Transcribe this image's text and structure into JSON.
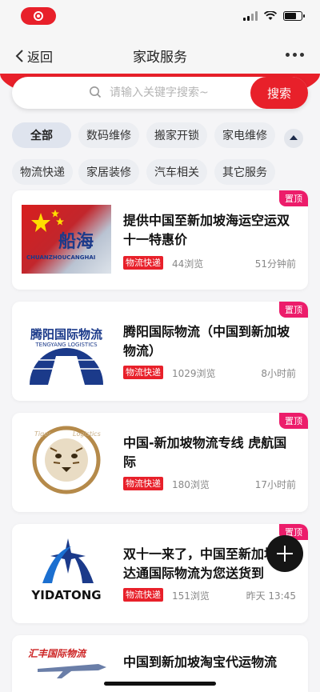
{
  "status_bar": {
    "record_icon": "screen-record-icon"
  },
  "nav": {
    "back_label": "返回",
    "title": "家政服务"
  },
  "search": {
    "placeholder": "请输入关键字搜索~",
    "button_label": "搜索"
  },
  "categories": [
    "全部",
    "数码维修",
    "搬家开锁",
    "家电维修",
    "物流快递",
    "家居装修",
    "汽车相关",
    "其它服务"
  ],
  "colors": {
    "accent": "#e8202a",
    "pin": "#ec1c6a"
  },
  "listings": [
    {
      "pin": "置顶",
      "title": "提供中国至新加坡海运空运双十一特惠价",
      "tag": "物流快递",
      "views": "44浏览",
      "time": "51分钟前",
      "thumb_text": "船海",
      "thumb_sub": "CHUANZHOUCANGHAI"
    },
    {
      "pin": "置顶",
      "title": "腾阳国际物流（中国到新加坡物流）",
      "tag": "物流快递",
      "views": "1029浏览",
      "time": "8小时前",
      "thumb_text": "腾阳国际物流",
      "thumb_sub": "TENGYANG LOGISTICS"
    },
    {
      "pin": "置顶",
      "title": "中国-新加坡物流专线 虎航国际",
      "tag": "物流快递",
      "views": "180浏览",
      "time": "17小时前",
      "thumb_text": "Tiger",
      "thumb_sub": "Logistics"
    },
    {
      "pin": "置顶",
      "title": "双十一来了，中国至新加坡易达通国际物流为您送货到",
      "tag": "物流快递",
      "views": "151浏览",
      "time": "昨天 13:45",
      "thumb_text": "YIDATONG"
    },
    {
      "title": "中国到新加坡淘宝代运物流",
      "thumb_text": "汇丰国际物流"
    }
  ]
}
